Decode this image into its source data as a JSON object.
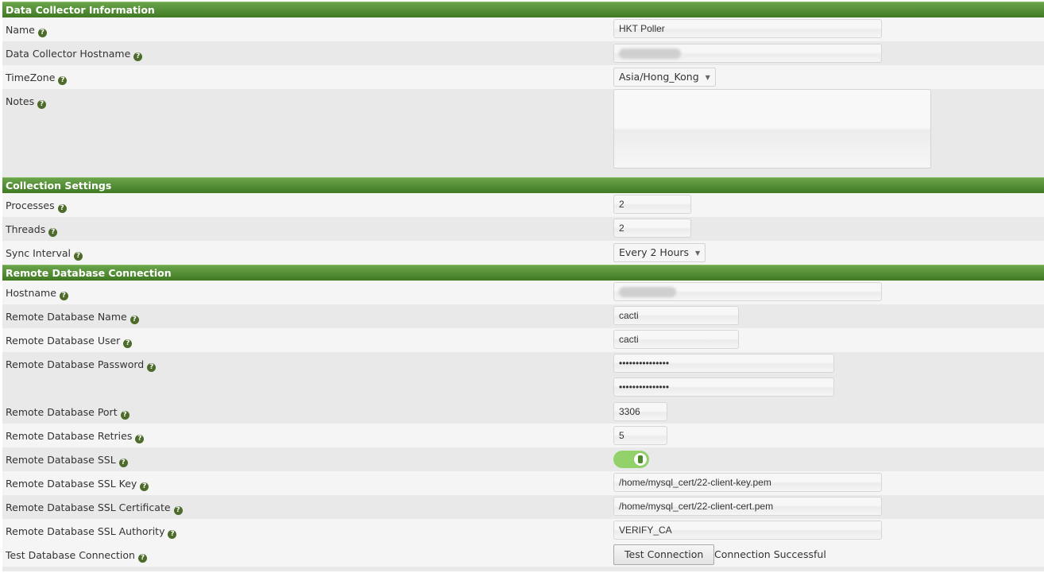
{
  "sections": {
    "collector": "Data Collector Information",
    "collection": "Collection Settings",
    "remote": "Remote Database Connection"
  },
  "help_glyph": "?",
  "fields": {
    "name": {
      "label": "Name",
      "value": "HKT Poller"
    },
    "hostname": {
      "label": "Data Collector Hostname",
      "value": ""
    },
    "timezone": {
      "label": "TimeZone",
      "value": "Asia/Hong_Kong"
    },
    "notes": {
      "label": "Notes",
      "value": ""
    },
    "processes": {
      "label": "Processes",
      "value": "2"
    },
    "threads": {
      "label": "Threads",
      "value": "2"
    },
    "sync_interval": {
      "label": "Sync Interval",
      "value": "Every 2 Hours"
    },
    "remote_hostname": {
      "label": "Hostname",
      "value": ""
    },
    "db_name": {
      "label": "Remote Database Name",
      "value": "cacti"
    },
    "db_user": {
      "label": "Remote Database User",
      "value": "cacti"
    },
    "db_password": {
      "label": "Remote Database Password",
      "value": "•••••••••••••••",
      "confirm": "•••••••••••••••"
    },
    "db_port": {
      "label": "Remote Database Port",
      "value": "3306"
    },
    "db_retries": {
      "label": "Remote Database Retries",
      "value": "5"
    },
    "db_ssl": {
      "label": "Remote Database SSL",
      "enabled": true
    },
    "ssl_key": {
      "label": "Remote Database SSL Key",
      "value": "/home/mysql_cert/22-client-key.pem"
    },
    "ssl_cert": {
      "label": "Remote Database SSL Certificate",
      "value": "/home/mysql_cert/22-client-cert.pem"
    },
    "ssl_authority": {
      "label": "Remote Database SSL Authority",
      "value": "VERIFY_CA"
    },
    "test_connection": {
      "label": "Test Database Connection",
      "button": "Test Connection",
      "status": "Connection Successful"
    }
  },
  "colors": {
    "header_green": "#4f8a2f",
    "toggle_on": "#93d26a",
    "help_icon": "#4d6b2a"
  }
}
